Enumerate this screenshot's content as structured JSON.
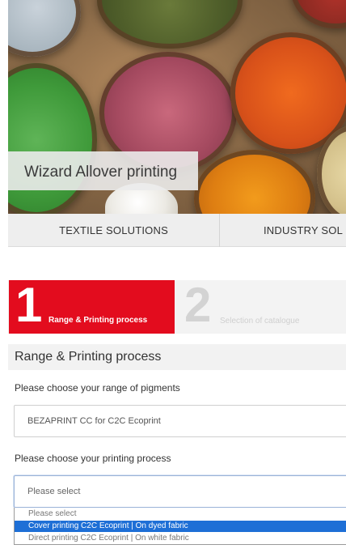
{
  "hero": {
    "title": "Wizard Allover printing"
  },
  "nav": {
    "items": [
      {
        "label": "TEXTILE SOLUTIONS"
      },
      {
        "label": "INDUSTRY SOL"
      }
    ]
  },
  "steps": [
    {
      "number": "1",
      "label": "Range & Printing process",
      "active": true
    },
    {
      "number": "2",
      "label": "Selection of catalogue",
      "active": false
    }
  ],
  "form": {
    "section_title": "Range & Printing process",
    "range_label": "Please choose your range of pigments",
    "range_value": "BEZAPRINT CC for C2C Ecoprint",
    "process_label": "Please choose your printing process",
    "process_value": "Please select",
    "process_options": [
      "Please select",
      "Cover printing C2C Ecoprint | On dyed fabric",
      "Direct printing C2C Ecoprint | On white fabric"
    ],
    "highlighted_option_index": 1
  },
  "colors": {
    "accent": "#e30c1e",
    "highlight": "#1e6fd6"
  }
}
